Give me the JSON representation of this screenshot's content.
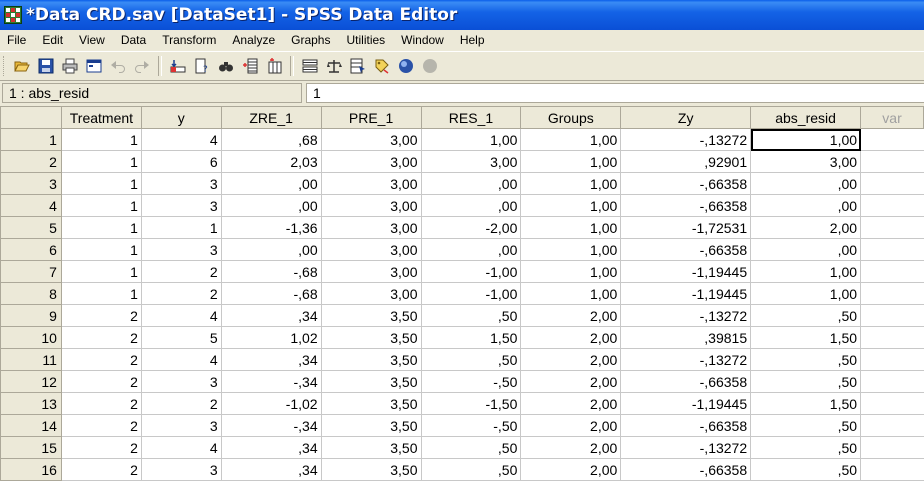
{
  "window": {
    "title": "*Data CRD.sav [DataSet1] - SPSS Data Editor"
  },
  "menu": [
    "File",
    "Edit",
    "View",
    "Data",
    "Transform",
    "Analyze",
    "Graphs",
    "Utilities",
    "Window",
    "Help"
  ],
  "toolbar": {
    "buttons": [
      {
        "name": "open-icon",
        "enabled": true
      },
      {
        "name": "save-icon",
        "enabled": true
      },
      {
        "name": "print-icon",
        "enabled": true
      },
      {
        "name": "dialog-recall-icon",
        "enabled": true
      },
      {
        "name": "undo-icon",
        "enabled": false
      },
      {
        "name": "redo-icon",
        "enabled": false
      },
      {
        "name": "go-to-case-icon",
        "enabled": true
      },
      {
        "name": "variables-icon",
        "enabled": true
      },
      {
        "name": "find-icon",
        "enabled": true
      },
      {
        "name": "insert-cases-icon",
        "enabled": true
      },
      {
        "name": "insert-variable-icon",
        "enabled": true
      },
      {
        "name": "split-file-icon",
        "enabled": true
      },
      {
        "name": "weight-cases-icon",
        "enabled": true
      },
      {
        "name": "select-cases-icon",
        "enabled": true
      },
      {
        "name": "value-labels-icon",
        "enabled": true
      },
      {
        "name": "use-variable-sets-icon",
        "enabled": true
      },
      {
        "name": "show-all-variables-icon",
        "enabled": false
      }
    ]
  },
  "cell_editor": {
    "reference": "1 : abs_resid",
    "value": "1"
  },
  "grid": {
    "columns": [
      "Treatment",
      "y",
      "ZRE_1",
      "PRE_1",
      "RES_1",
      "Groups",
      "Zy",
      "abs_resid",
      "var"
    ],
    "rows": [
      [
        "1",
        "1",
        "4",
        ",68",
        "3,00",
        "1,00",
        "1,00",
        "-,13272",
        "1,00"
      ],
      [
        "2",
        "1",
        "6",
        "2,03",
        "3,00",
        "3,00",
        "1,00",
        ",92901",
        "3,00"
      ],
      [
        "3",
        "1",
        "3",
        ",00",
        "3,00",
        ",00",
        "1,00",
        "-,66358",
        ",00"
      ],
      [
        "4",
        "1",
        "3",
        ",00",
        "3,00",
        ",00",
        "1,00",
        "-,66358",
        ",00"
      ],
      [
        "5",
        "1",
        "1",
        "-1,36",
        "3,00",
        "-2,00",
        "1,00",
        "-1,72531",
        "2,00"
      ],
      [
        "6",
        "1",
        "3",
        ",00",
        "3,00",
        ",00",
        "1,00",
        "-,66358",
        ",00"
      ],
      [
        "7",
        "1",
        "2",
        "-,68",
        "3,00",
        "-1,00",
        "1,00",
        "-1,19445",
        "1,00"
      ],
      [
        "8",
        "1",
        "2",
        "-,68",
        "3,00",
        "-1,00",
        "1,00",
        "-1,19445",
        "1,00"
      ],
      [
        "9",
        "2",
        "4",
        ",34",
        "3,50",
        ",50",
        "2,00",
        "-,13272",
        ",50"
      ],
      [
        "10",
        "2",
        "5",
        "1,02",
        "3,50",
        "1,50",
        "2,00",
        ",39815",
        "1,50"
      ],
      [
        "11",
        "2",
        "4",
        ",34",
        "3,50",
        ",50",
        "2,00",
        "-,13272",
        ",50"
      ],
      [
        "12",
        "2",
        "3",
        "-,34",
        "3,50",
        "-,50",
        "2,00",
        "-,66358",
        ",50"
      ],
      [
        "13",
        "2",
        "2",
        "-1,02",
        "3,50",
        "-1,50",
        "2,00",
        "-1,19445",
        "1,50"
      ],
      [
        "14",
        "2",
        "3",
        "-,34",
        "3,50",
        "-,50",
        "2,00",
        "-,66358",
        ",50"
      ],
      [
        "15",
        "2",
        "4",
        ",34",
        "3,50",
        ",50",
        "2,00",
        "-,13272",
        ",50"
      ],
      [
        "16",
        "2",
        "3",
        ",34",
        "3,50",
        ",50",
        "2,00",
        "-,66358",
        ",50"
      ]
    ],
    "active_cell": {
      "row": 0,
      "column": "abs_resid"
    }
  }
}
